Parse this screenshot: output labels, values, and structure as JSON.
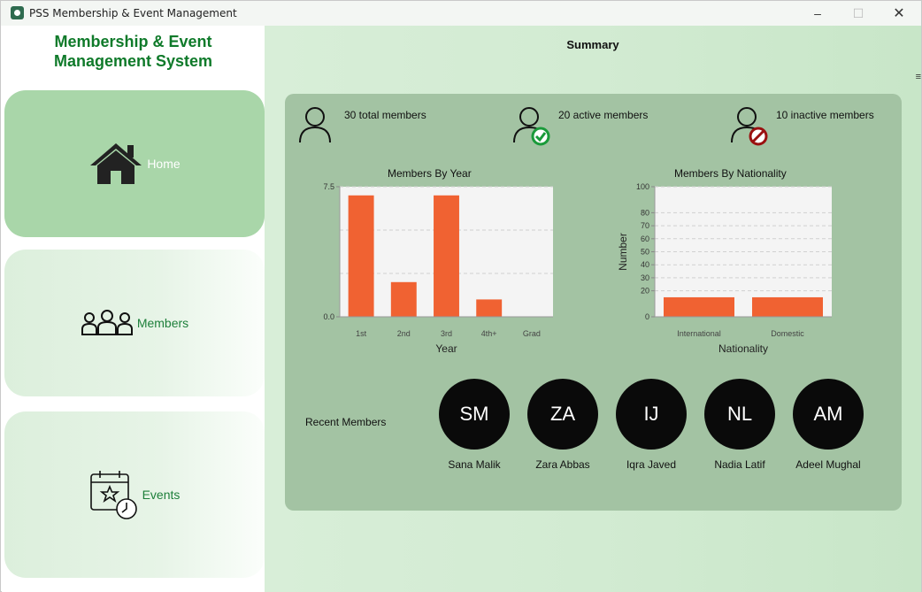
{
  "window": {
    "title": "PSS Membership & Event Management",
    "min": "–",
    "max": "☐",
    "close": "✕"
  },
  "sidebar": {
    "heading_line1": "Membership & Event",
    "heading_line2": "Management System",
    "items": [
      {
        "label": "Home",
        "icon": "home-icon"
      },
      {
        "label": "Members",
        "icon": "members-icon"
      },
      {
        "label": "Events",
        "icon": "events-calendar-icon"
      }
    ]
  },
  "main": {
    "title": "Summary",
    "edge_mark": "≡",
    "stats": [
      {
        "text": "30 total members",
        "icon": "user-icon"
      },
      {
        "text": "20 active members",
        "icon": "user-check-icon"
      },
      {
        "text": "10 inactive members",
        "icon": "user-blocked-icon"
      }
    ],
    "recent_label": "Recent Members",
    "recent_members": [
      {
        "initials": "SM",
        "name": "Sana Malik"
      },
      {
        "initials": "ZA",
        "name": "Zara Abbas"
      },
      {
        "initials": "IJ",
        "name": "Iqra Javed"
      },
      {
        "initials": "NL",
        "name": "Nadia Latif"
      },
      {
        "initials": "AM",
        "name": "Adeel Mughal"
      }
    ]
  },
  "colors": {
    "bar": "#f06232",
    "card": "#a3c3a3",
    "accent": "#0f7a2a",
    "check": "#1a9a3a",
    "block": "#9a1010"
  },
  "chart_data": [
    {
      "type": "bar",
      "title": "Members By Year",
      "xlabel": "Year",
      "ylabel": "",
      "categories": [
        "1st",
        "2nd",
        "3rd",
        "4th+",
        "Grad"
      ],
      "values": [
        7,
        2,
        7,
        1,
        0
      ],
      "ylim": [
        0,
        7.5
      ],
      "yticks": [
        "0.0",
        "7.5"
      ],
      "grid": true
    },
    {
      "type": "bar",
      "title": "Members By Nationality",
      "xlabel": "Nationality",
      "ylabel": "Number",
      "categories": [
        "International",
        "Domestic"
      ],
      "values": [
        15,
        15
      ],
      "ylim": [
        0,
        100
      ],
      "yticks": [
        "0",
        "20",
        "30",
        "40",
        "50",
        "60",
        "70",
        "80",
        "100"
      ],
      "grid": true
    }
  ]
}
